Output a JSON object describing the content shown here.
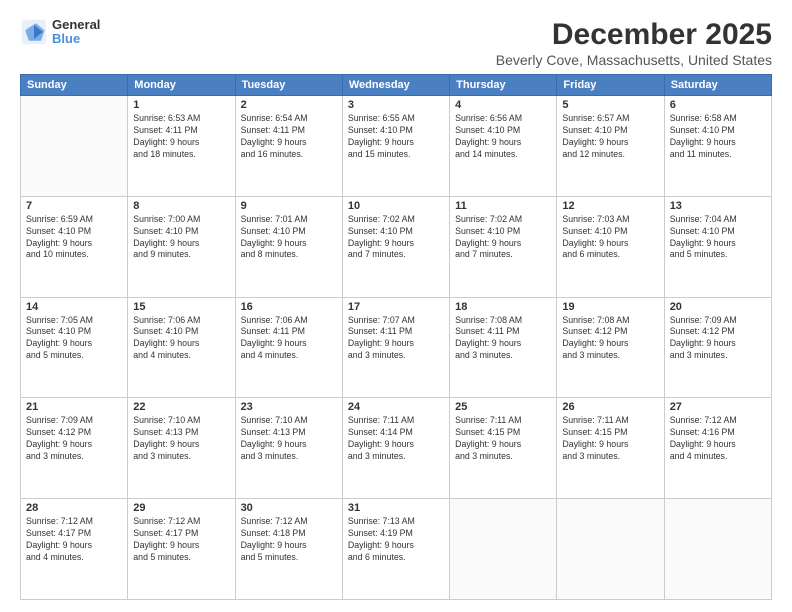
{
  "logo": {
    "general": "General",
    "blue": "Blue"
  },
  "header": {
    "month": "December 2025",
    "location": "Beverly Cove, Massachusetts, United States"
  },
  "days_of_week": [
    "Sunday",
    "Monday",
    "Tuesday",
    "Wednesday",
    "Thursday",
    "Friday",
    "Saturday"
  ],
  "weeks": [
    [
      {
        "day": "",
        "info": ""
      },
      {
        "day": "1",
        "info": "Sunrise: 6:53 AM\nSunset: 4:11 PM\nDaylight: 9 hours\nand 18 minutes."
      },
      {
        "day": "2",
        "info": "Sunrise: 6:54 AM\nSunset: 4:11 PM\nDaylight: 9 hours\nand 16 minutes."
      },
      {
        "day": "3",
        "info": "Sunrise: 6:55 AM\nSunset: 4:10 PM\nDaylight: 9 hours\nand 15 minutes."
      },
      {
        "day": "4",
        "info": "Sunrise: 6:56 AM\nSunset: 4:10 PM\nDaylight: 9 hours\nand 14 minutes."
      },
      {
        "day": "5",
        "info": "Sunrise: 6:57 AM\nSunset: 4:10 PM\nDaylight: 9 hours\nand 12 minutes."
      },
      {
        "day": "6",
        "info": "Sunrise: 6:58 AM\nSunset: 4:10 PM\nDaylight: 9 hours\nand 11 minutes."
      }
    ],
    [
      {
        "day": "7",
        "info": "Sunrise: 6:59 AM\nSunset: 4:10 PM\nDaylight: 9 hours\nand 10 minutes."
      },
      {
        "day": "8",
        "info": "Sunrise: 7:00 AM\nSunset: 4:10 PM\nDaylight: 9 hours\nand 9 minutes."
      },
      {
        "day": "9",
        "info": "Sunrise: 7:01 AM\nSunset: 4:10 PM\nDaylight: 9 hours\nand 8 minutes."
      },
      {
        "day": "10",
        "info": "Sunrise: 7:02 AM\nSunset: 4:10 PM\nDaylight: 9 hours\nand 7 minutes."
      },
      {
        "day": "11",
        "info": "Sunrise: 7:02 AM\nSunset: 4:10 PM\nDaylight: 9 hours\nand 7 minutes."
      },
      {
        "day": "12",
        "info": "Sunrise: 7:03 AM\nSunset: 4:10 PM\nDaylight: 9 hours\nand 6 minutes."
      },
      {
        "day": "13",
        "info": "Sunrise: 7:04 AM\nSunset: 4:10 PM\nDaylight: 9 hours\nand 5 minutes."
      }
    ],
    [
      {
        "day": "14",
        "info": "Sunrise: 7:05 AM\nSunset: 4:10 PM\nDaylight: 9 hours\nand 5 minutes."
      },
      {
        "day": "15",
        "info": "Sunrise: 7:06 AM\nSunset: 4:10 PM\nDaylight: 9 hours\nand 4 minutes."
      },
      {
        "day": "16",
        "info": "Sunrise: 7:06 AM\nSunset: 4:11 PM\nDaylight: 9 hours\nand 4 minutes."
      },
      {
        "day": "17",
        "info": "Sunrise: 7:07 AM\nSunset: 4:11 PM\nDaylight: 9 hours\nand 3 minutes."
      },
      {
        "day": "18",
        "info": "Sunrise: 7:08 AM\nSunset: 4:11 PM\nDaylight: 9 hours\nand 3 minutes."
      },
      {
        "day": "19",
        "info": "Sunrise: 7:08 AM\nSunset: 4:12 PM\nDaylight: 9 hours\nand 3 minutes."
      },
      {
        "day": "20",
        "info": "Sunrise: 7:09 AM\nSunset: 4:12 PM\nDaylight: 9 hours\nand 3 minutes."
      }
    ],
    [
      {
        "day": "21",
        "info": "Sunrise: 7:09 AM\nSunset: 4:12 PM\nDaylight: 9 hours\nand 3 minutes."
      },
      {
        "day": "22",
        "info": "Sunrise: 7:10 AM\nSunset: 4:13 PM\nDaylight: 9 hours\nand 3 minutes."
      },
      {
        "day": "23",
        "info": "Sunrise: 7:10 AM\nSunset: 4:13 PM\nDaylight: 9 hours\nand 3 minutes."
      },
      {
        "day": "24",
        "info": "Sunrise: 7:11 AM\nSunset: 4:14 PM\nDaylight: 9 hours\nand 3 minutes."
      },
      {
        "day": "25",
        "info": "Sunrise: 7:11 AM\nSunset: 4:15 PM\nDaylight: 9 hours\nand 3 minutes."
      },
      {
        "day": "26",
        "info": "Sunrise: 7:11 AM\nSunset: 4:15 PM\nDaylight: 9 hours\nand 3 minutes."
      },
      {
        "day": "27",
        "info": "Sunrise: 7:12 AM\nSunset: 4:16 PM\nDaylight: 9 hours\nand 4 minutes."
      }
    ],
    [
      {
        "day": "28",
        "info": "Sunrise: 7:12 AM\nSunset: 4:17 PM\nDaylight: 9 hours\nand 4 minutes."
      },
      {
        "day": "29",
        "info": "Sunrise: 7:12 AM\nSunset: 4:17 PM\nDaylight: 9 hours\nand 5 minutes."
      },
      {
        "day": "30",
        "info": "Sunrise: 7:12 AM\nSunset: 4:18 PM\nDaylight: 9 hours\nand 5 minutes."
      },
      {
        "day": "31",
        "info": "Sunrise: 7:13 AM\nSunset: 4:19 PM\nDaylight: 9 hours\nand 6 minutes."
      },
      {
        "day": "",
        "info": ""
      },
      {
        "day": "",
        "info": ""
      },
      {
        "day": "",
        "info": ""
      }
    ]
  ]
}
